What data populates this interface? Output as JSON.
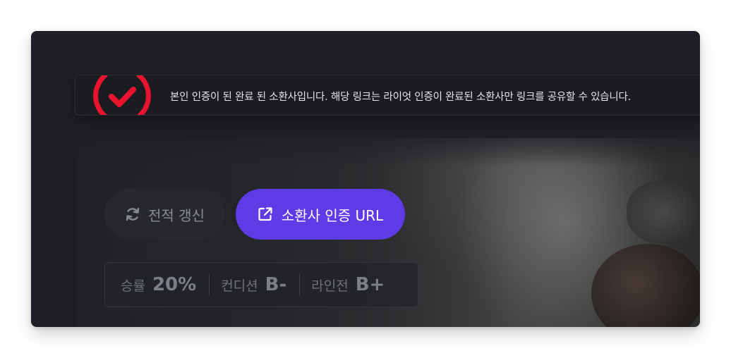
{
  "banner": {
    "message": "본인 인증이 된 완료 된 소환사입니다. 해당 링크는 라이엇 인증이 완료된 소환사만 링크를 공유할 수 있습니다.",
    "badge_icon": "verified-check-icon",
    "accent_color": "#e8132e"
  },
  "actions": {
    "refresh_label": "전적 갱신",
    "refresh_icon": "refresh-icon",
    "verify_url_label": "소환사 인증 URL",
    "verify_url_icon": "external-link-icon",
    "verify_url_color": "#5d3ce6"
  },
  "stats": [
    {
      "label": "승률",
      "value": "20%"
    },
    {
      "label": "컨디션",
      "value": "B-"
    },
    {
      "label": "라인전",
      "value": "B+"
    }
  ]
}
